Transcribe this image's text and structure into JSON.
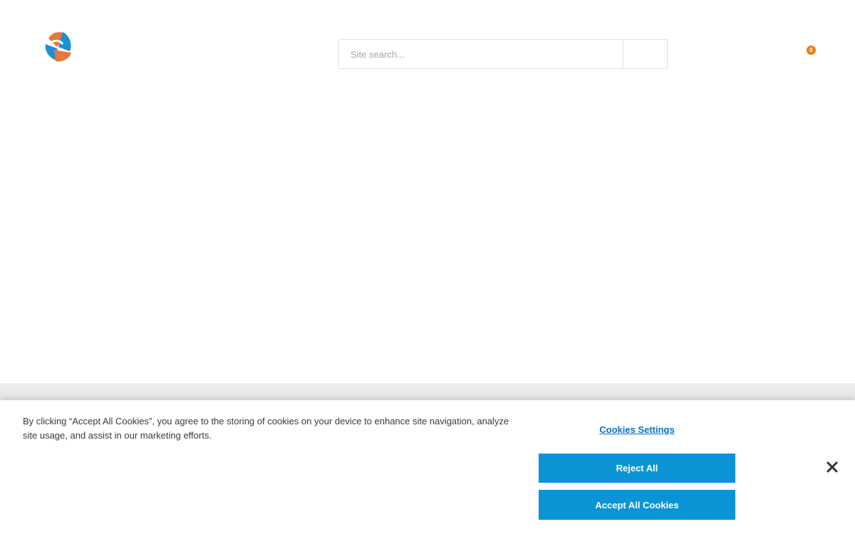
{
  "header": {
    "logo_name": "brand-logo",
    "search": {
      "placeholder": "Site search...",
      "value": ""
    },
    "cart": {
      "count": "0",
      "icon": "cart-icon"
    }
  },
  "cookie_banner": {
    "message": "By clicking “Accept All Cookies”, you agree to the storing of cookies on your device to enhance site navigation, analyze site usage, and assist in our marketing efforts.",
    "settings_label": "Cookies Settings",
    "reject_label": "Reject All",
    "accept_label": "Accept All Cookies",
    "close_icon": "close-icon"
  },
  "colors": {
    "accent_blue": "#0a94d6",
    "link_blue": "#0a6fbf",
    "badge_orange": "#e8800e",
    "logo_orange": "#e8773a",
    "logo_blue": "#1e8fd6"
  }
}
